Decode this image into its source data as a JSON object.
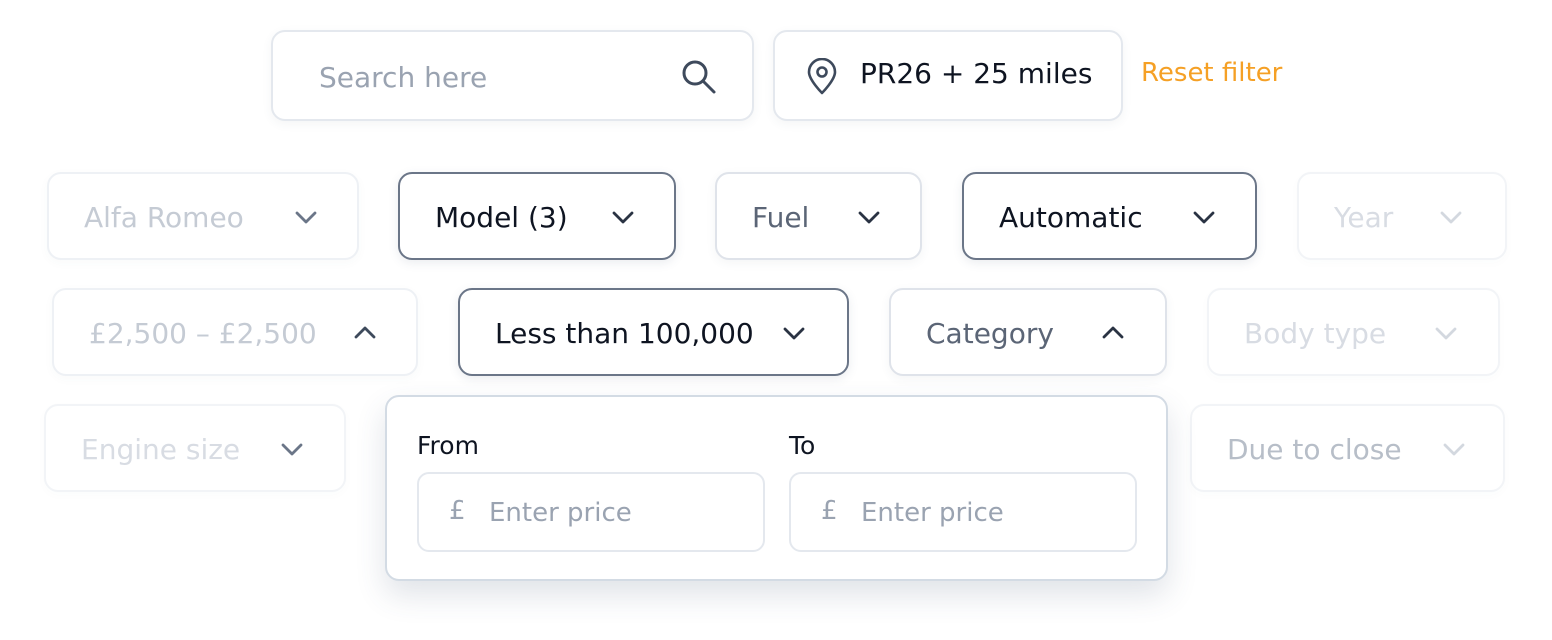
{
  "search": {
    "placeholder": "Search here",
    "icon": "search-icon"
  },
  "location": {
    "text": "PR26 + 25 miles",
    "icon": "location-pin-icon"
  },
  "reset_label": "Reset filter",
  "colors": {
    "accent": "#f5a025",
    "active_border": "#6b7688",
    "text_dark": "#0e1421",
    "text_muted": "#9aa3b1"
  },
  "filters": {
    "make": "Alfa Romeo",
    "model": "Model (3)",
    "fuel": "Fuel",
    "transmission": "Automatic",
    "year": "Year",
    "price": "£2,500 – £2,500",
    "mileage": "Less than 100,000",
    "category": "Category",
    "body_type": "Body type",
    "engine_size": "Engine size",
    "due_to_close": "Due to close"
  },
  "price_panel": {
    "from_label": "From",
    "to_label": "To",
    "currency": "£",
    "from_placeholder": "Enter price",
    "to_placeholder": "Enter price"
  }
}
